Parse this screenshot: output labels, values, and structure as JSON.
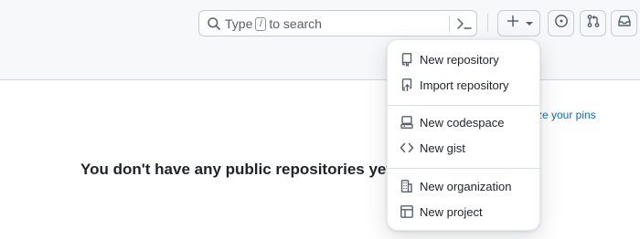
{
  "header": {
    "search": {
      "prefix": "Type",
      "key": "/",
      "suffix": "to search"
    }
  },
  "main": {
    "customize_link": "ze your pins",
    "empty_message": "You don't have any public repositories yet."
  },
  "create_menu": {
    "groups": [
      [
        {
          "label": "New repository",
          "icon": "repo-icon"
        },
        {
          "label": "Import repository",
          "icon": "repo-push-icon"
        }
      ],
      [
        {
          "label": "New codespace",
          "icon": "codespaces-icon"
        },
        {
          "label": "New gist",
          "icon": "code-icon"
        }
      ],
      [
        {
          "label": "New organization",
          "icon": "organization-icon"
        },
        {
          "label": "New project",
          "icon": "table-icon"
        }
      ]
    ]
  },
  "colors": {
    "link": "#0969da",
    "text": "#1f2328",
    "muted": "#57606a",
    "header_bg": "#f6f8fa",
    "border": "#d0d7de"
  }
}
